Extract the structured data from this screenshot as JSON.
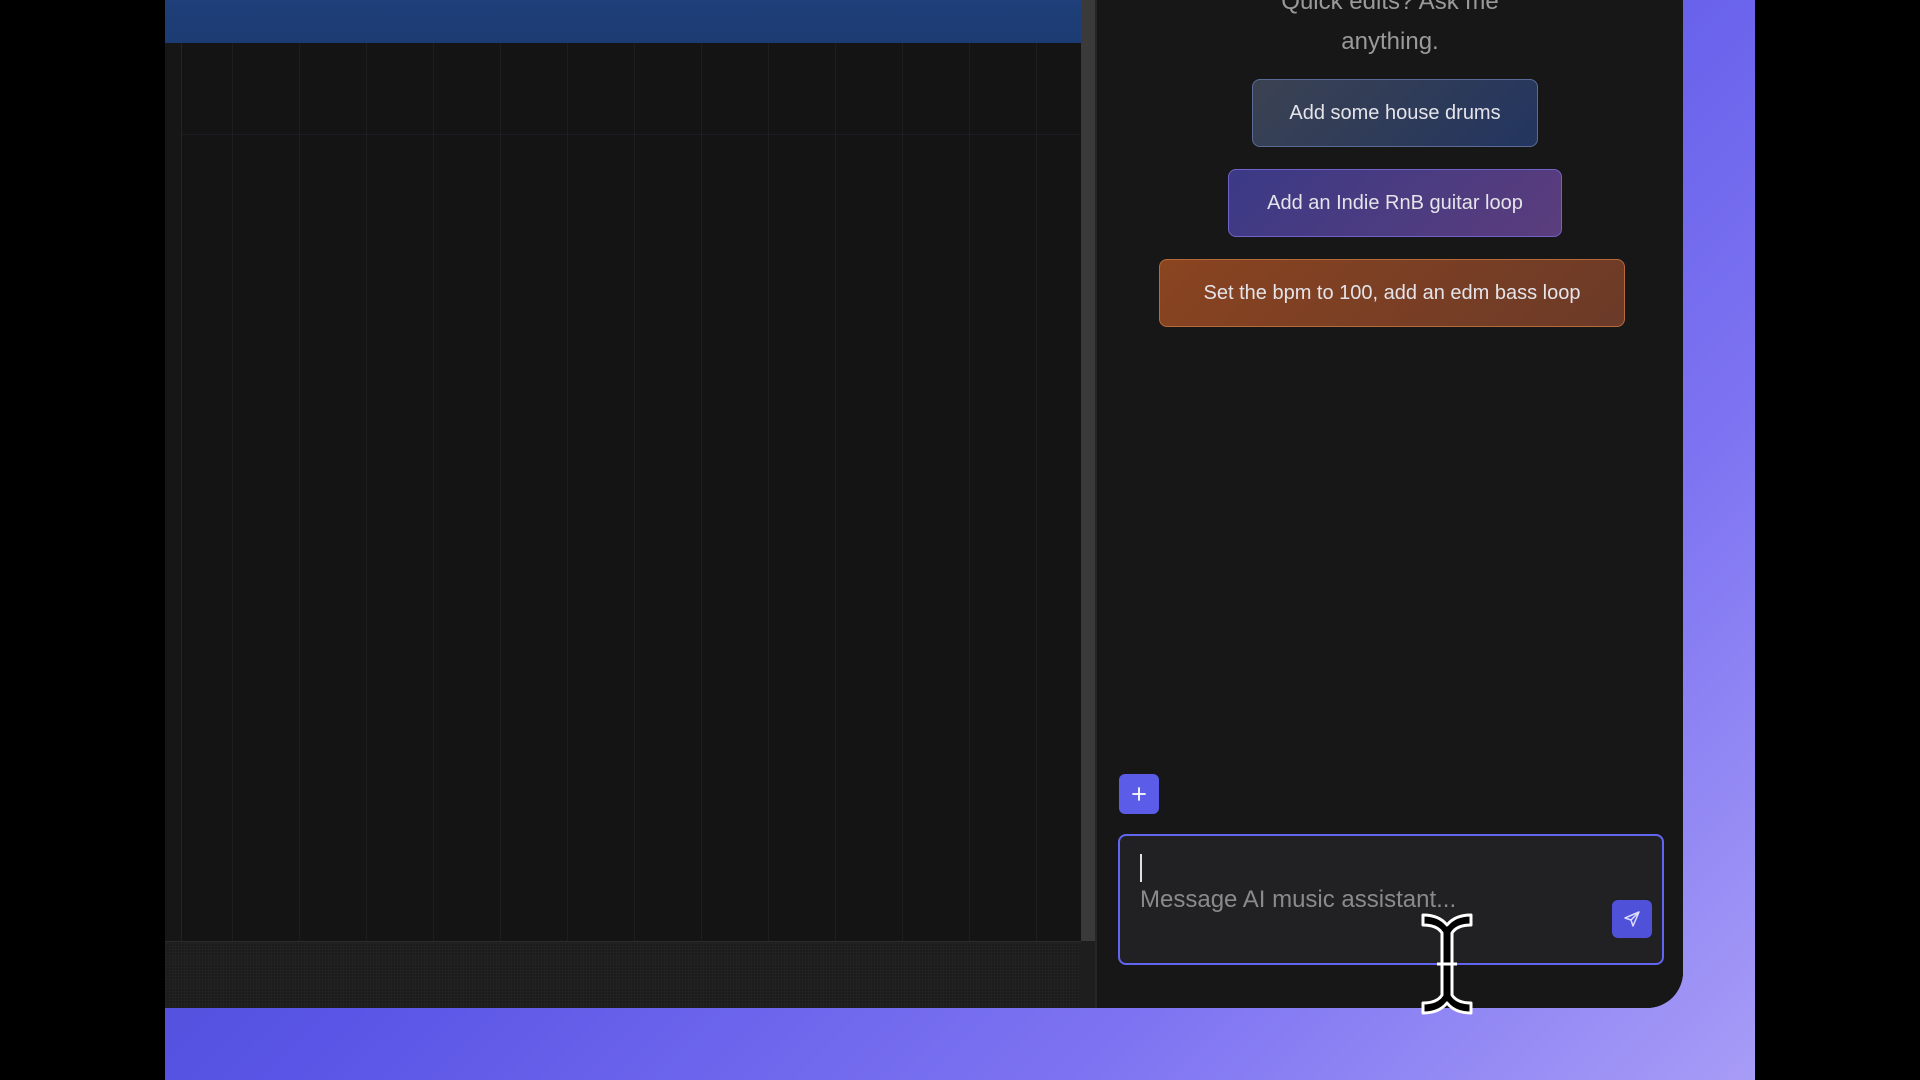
{
  "chat": {
    "intro_line1": "Quick edits? Ask me",
    "intro_line2": "anything.",
    "suggestions": [
      {
        "label": "Add some house drums"
      },
      {
        "label": "Add an Indie RnB guitar loop"
      },
      {
        "label": "Set the bpm to 100, add an edm bass loop"
      }
    ],
    "add_icon": "plus-icon",
    "input": {
      "value": "",
      "placeholder": "Message AI music assistant..."
    },
    "send_icon": "send-icon"
  },
  "colors": {
    "accent": "#5b5ce8",
    "input_border": "#6265f0",
    "panel_bg": "#171717"
  }
}
